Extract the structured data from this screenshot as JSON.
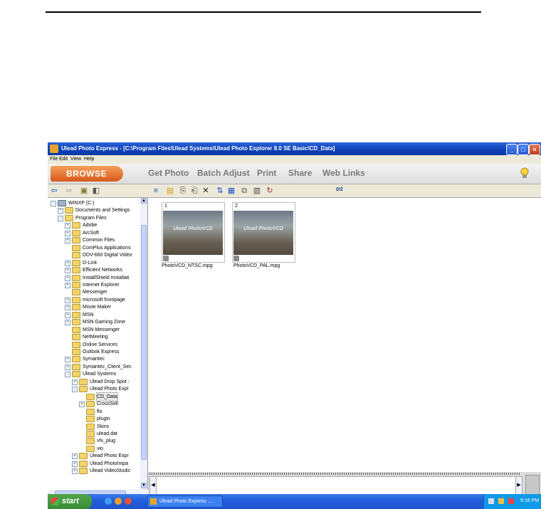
{
  "window": {
    "title": "Ulead Photo Express - [C:\\Program Files\\Ulead Systems\\Ulead Photo Explorer 8.0 SE Basic\\CD_Data]"
  },
  "menu": [
    "File",
    "Edit",
    "View",
    "Help"
  ],
  "nav": {
    "browse_label": "BROWSE",
    "items": [
      "Get Photo",
      "Batch Adjust",
      "Print",
      "Share",
      "Web Links"
    ]
  },
  "toolbar": {
    "counter": "0/2"
  },
  "tree": [
    {
      "label": "WINXP (C:)",
      "depth": 0,
      "expander": "−"
    },
    {
      "label": "Documents and Settings",
      "depth": 1,
      "expander": "+"
    },
    {
      "label": "Program Files",
      "depth": 1,
      "expander": "−"
    },
    {
      "label": "Adobe",
      "depth": 2,
      "expander": "+"
    },
    {
      "label": "ArcSoft",
      "depth": 2,
      "expander": "+"
    },
    {
      "label": "Common Files",
      "depth": 2,
      "expander": "+"
    },
    {
      "label": "ComPlus Applications",
      "depth": 2,
      "expander": ""
    },
    {
      "label": "DDV-660 Digital Video",
      "depth": 2,
      "expander": ""
    },
    {
      "label": "D-Link",
      "depth": 2,
      "expander": "+"
    },
    {
      "label": "Efficient Networks",
      "depth": 2,
      "expander": "+"
    },
    {
      "label": "InstallShield Installati",
      "depth": 2,
      "expander": "+"
    },
    {
      "label": "Internet Explorer",
      "depth": 2,
      "expander": "+"
    },
    {
      "label": "Messenger",
      "depth": 2,
      "expander": ""
    },
    {
      "label": "microsoft frontpage",
      "depth": 2,
      "expander": "+"
    },
    {
      "label": "Movie Maker",
      "depth": 2,
      "expander": "+"
    },
    {
      "label": "MSN",
      "depth": 2,
      "expander": "+"
    },
    {
      "label": "MSN Gaming Zone",
      "depth": 2,
      "expander": "+"
    },
    {
      "label": "MSN Messenger",
      "depth": 2,
      "expander": ""
    },
    {
      "label": "NetMeeting",
      "depth": 2,
      "expander": ""
    },
    {
      "label": "Online Services",
      "depth": 2,
      "expander": ""
    },
    {
      "label": "Outlook Express",
      "depth": 2,
      "expander": ""
    },
    {
      "label": "Symantec",
      "depth": 2,
      "expander": "+"
    },
    {
      "label": "Symantec_Client_Sec",
      "depth": 2,
      "expander": "+"
    },
    {
      "label": "Ulead Systems",
      "depth": 2,
      "expander": "−"
    },
    {
      "label": "Ulead Drop Spot :",
      "depth": 3,
      "expander": "+"
    },
    {
      "label": "Ulead Photo Expl",
      "depth": 3,
      "expander": "−"
    },
    {
      "label": "CD_Data",
      "depth": 4,
      "expander": "",
      "selected": true
    },
    {
      "label": "CrossSell",
      "depth": 4,
      "expander": "+"
    },
    {
      "label": "flo",
      "depth": 4,
      "expander": ""
    },
    {
      "label": "plugin",
      "depth": 4,
      "expander": ""
    },
    {
      "label": "Skins",
      "depth": 4,
      "expander": ""
    },
    {
      "label": "ulead.dat",
      "depth": 4,
      "expander": ""
    },
    {
      "label": "vfx_plug",
      "depth": 4,
      "expander": ""
    },
    {
      "label": "vio",
      "depth": 4,
      "expander": ""
    },
    {
      "label": "Ulead Photo Expr",
      "depth": 3,
      "expander": "+"
    },
    {
      "label": "Ulead PhotoImpa",
      "depth": 3,
      "expander": "+"
    },
    {
      "label": "Ulead VideoStudic",
      "depth": 3,
      "expander": "+"
    }
  ],
  "thumbnails": [
    {
      "index": "1",
      "caption": "Ulead PhotoVCD",
      "filename": "PhotoVCD_NTSC.mpg"
    },
    {
      "index": "2",
      "caption": "Ulead PhotoVCD",
      "filename": "PhotoVCD_PAL.mpg"
    }
  ],
  "taskbar": {
    "start_label": "start",
    "task_label": "Ulead Photo Express ...",
    "clock": "9:16 PM"
  }
}
